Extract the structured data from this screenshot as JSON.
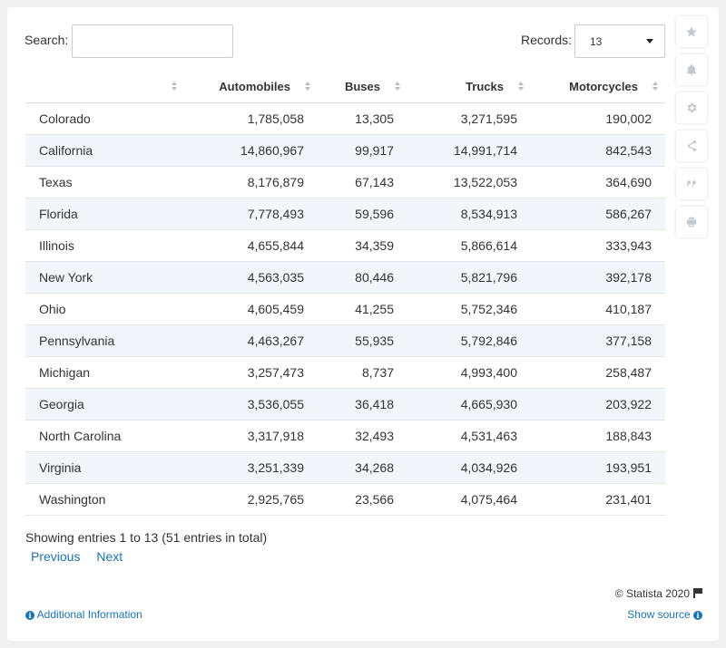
{
  "search": {
    "label": "Search:",
    "value": ""
  },
  "records": {
    "label": "Records:",
    "selected": "13"
  },
  "chart_data": {
    "type": "table",
    "columns": [
      "",
      "Automobiles",
      "Buses",
      "Trucks",
      "Motorcycles"
    ],
    "rows": [
      [
        "Colorado",
        "1,785,058",
        "13,305",
        "3,271,595",
        "190,002"
      ],
      [
        "California",
        "14,860,967",
        "99,917",
        "14,991,714",
        "842,543"
      ],
      [
        "Texas",
        "8,176,879",
        "67,143",
        "13,522,053",
        "364,690"
      ],
      [
        "Florida",
        "7,778,493",
        "59,596",
        "8,534,913",
        "586,267"
      ],
      [
        "Illinois",
        "4,655,844",
        "34,359",
        "5,866,614",
        "333,943"
      ],
      [
        "New York",
        "4,563,035",
        "80,446",
        "5,821,796",
        "392,178"
      ],
      [
        "Ohio",
        "4,605,459",
        "41,255",
        "5,752,346",
        "410,187"
      ],
      [
        "Pennsylvania",
        "4,463,267",
        "55,935",
        "5,792,846",
        "377,158"
      ],
      [
        "Michigan",
        "3,257,473",
        "8,737",
        "4,993,400",
        "258,487"
      ],
      [
        "Georgia",
        "3,536,055",
        "36,418",
        "4,665,930",
        "203,922"
      ],
      [
        "North Carolina",
        "3,317,918",
        "32,493",
        "4,531,463",
        "188,843"
      ],
      [
        "Virginia",
        "3,251,339",
        "34,268",
        "4,034,926",
        "193,951"
      ],
      [
        "Washington",
        "2,925,765",
        "23,566",
        "4,075,464",
        "231,401"
      ]
    ]
  },
  "entries_info": "Showing entries 1 to 13 (51 entries in total)",
  "pager": {
    "previous": "Previous",
    "next": "Next"
  },
  "footer": {
    "copyright": "© Statista 2020",
    "additional_info": "Additional Information",
    "show_source": "Show source"
  },
  "sidebar_icons": [
    "star-icon",
    "bell-icon",
    "gear-icon",
    "share-icon",
    "quote-icon",
    "print-icon"
  ],
  "colors": {
    "link": "#1a73b8",
    "row_alt": "#f2f5f9",
    "icon": "#c4c9cf"
  }
}
